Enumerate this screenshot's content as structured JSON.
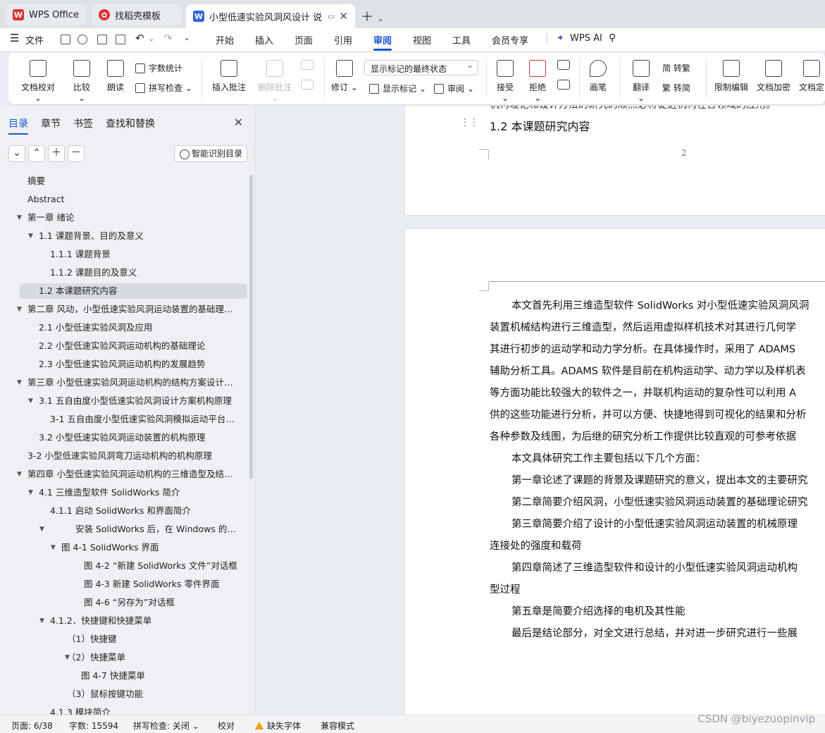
{
  "tabs": [
    {
      "label": "WPS Office",
      "icon": "wps-logo-icon"
    },
    {
      "label": "找稻壳模板",
      "icon": "docer-icon"
    },
    {
      "label": "小型低速实验风洞风设计 说明书",
      "icon": "word-doc-icon",
      "active": true
    }
  ],
  "menu": {
    "file": "文件",
    "items": [
      "开始",
      "插入",
      "页面",
      "引用",
      "审阅",
      "视图",
      "工具",
      "会员专享"
    ],
    "active": "审阅",
    "ai": "WPS AI"
  },
  "ribbon": {
    "doc_proof": "文档校对",
    "compare": "比较",
    "read_aloud": "朗读",
    "word_count": "字数统计",
    "spell_check": "拼写检查",
    "insert_comment": "插入批注",
    "delete_comment": "删除批注",
    "revise": "修订",
    "markup_dropdown": "显示标记的最终状态",
    "show_markup": "显示标记",
    "review": "审阅",
    "accept": "接受",
    "reject": "拒绝",
    "pen": "画笔",
    "translate": "翻译",
    "to_traditional": "简 转繁",
    "to_simplified": "繁 转简",
    "restrict_edit": "限制编辑",
    "encrypt": "文档加密",
    "finalize": "文档定"
  },
  "nav": {
    "tabs": [
      "目录",
      "章节",
      "书签",
      "查找和替换"
    ],
    "active_tab": "目录",
    "smart_button": "智能识别目录",
    "toc": [
      {
        "text": "摘要",
        "level": 0,
        "arrow": ""
      },
      {
        "text": "Abstract",
        "level": 0,
        "arrow": ""
      },
      {
        "text": "第一章  绪论",
        "level": 0,
        "arrow": "down"
      },
      {
        "text": "1.1 课题背景、目的及意义",
        "level": 1,
        "arrow": "down"
      },
      {
        "text": "1.1.1 课题背景",
        "level": 2,
        "arrow": ""
      },
      {
        "text": "1.1.2 课题目的及意义",
        "level": 2,
        "arrow": ""
      },
      {
        "text": "1.2 本课题研究内容",
        "level": 1,
        "arrow": "",
        "selected": true
      },
      {
        "text": "第二章  风动，小型低速实验风洞运动装置的基础理论 ...",
        "level": 0,
        "arrow": "down"
      },
      {
        "text": "2.1 小型低速实验风洞及应用",
        "level": 1,
        "arrow": ""
      },
      {
        "text": "2.2 小型低速实验风洞运动机构的基础理论",
        "level": 1,
        "arrow": ""
      },
      {
        "text": "2.3 小型低速实验风洞运动机构的发展趋势",
        "level": 1,
        "arrow": ""
      },
      {
        "text": "第三章  小型低速实验风洞运动机构的结构方案设计和 ...",
        "level": 0,
        "arrow": "down"
      },
      {
        "text": "3.1 五自由度小型低速实验风洞设计方案机构原理",
        "level": 1,
        "arrow": "down"
      },
      {
        "text": "3-1 五自由度小型低速实验风洞模拟运动平台的 ...",
        "level": 2,
        "arrow": ""
      },
      {
        "text": "3.2 小型低速实验风洞运动装置的机构原理",
        "level": 1,
        "arrow": ""
      },
      {
        "text": "3-2 小型低速实验风洞弯刀运动机构的机构原理",
        "level": 0,
        "arrow": ""
      },
      {
        "text": "第四章    小型低速实验风洞运动机构的三维造型及结构 ...",
        "level": 0,
        "arrow": "down"
      },
      {
        "text": "4.1 三维造型软件 SolidWorks 简介",
        "level": 1,
        "arrow": "down"
      },
      {
        "text": "4.1.1 启动 SolidWorks 和界面简介",
        "level": 2,
        "arrow": ""
      },
      {
        "text": "安装 SolidWorks 后，在 Windows 的操 ...",
        "level": 4,
        "arrow": "down",
        "arrow_level": 2
      },
      {
        "text": "图 4-1    SolidWorks 界面",
        "level": 3,
        "arrow": "down"
      },
      {
        "text": "图 4-2  “新建 SolidWorks 文件”对话框",
        "level": 5,
        "arrow": ""
      },
      {
        "text": "图 4-3    新建 SolidWorks 零件界面",
        "level": 5,
        "arrow": ""
      },
      {
        "text": "图 4-6  “另存为”对话框",
        "level": 5,
        "arrow": ""
      },
      {
        "text": "4.1.2．快捷键和快捷菜单",
        "level": 2,
        "arrow": "down"
      },
      {
        "text": "（1）快捷键",
        "level": 3.4,
        "arrow": ""
      },
      {
        "text": "（2）快捷菜单",
        "level": 3.4,
        "arrow": "down"
      },
      {
        "text": "图 4-7    快捷菜单",
        "level": 4.4,
        "arrow": ""
      },
      {
        "text": "（3）鼠标按键功能",
        "level": 3.4,
        "arrow": ""
      },
      {
        "text": "4.1.3    模块简介",
        "level": 2,
        "arrow": ""
      }
    ]
  },
  "document": {
    "cut_line": "机构理论和设计方法的研究的顺然必将促进机构在各领域的应用。",
    "heading": "1.2 本课题研究内容",
    "page_number": "2",
    "paragraphs": [
      "本文首先利用三维造型软件 SolidWorks 对小型低速实验风洞风洞",
      "装置机械结构进行三维造型，然后运用虚拟样机技术对其进行几何学",
      "其进行初步的运动学和动力学分析。在具体操作时，采用了 ADAMS",
      "辅助分析工具。ADAMS 软件是目前在机构运动学、动力学以及样机表",
      "等方面功能比较强大的软件之一，并联机构运动的复杂性可以利用 A",
      "供的这些功能进行分析，并可以方便、快捷地得到可视化的结果和分析",
      "各种参数及线图，为后继的研究分析工作提供比较直观的可参考依据",
      "本文具体研究工作主要包括以下几个方面：",
      "第一章论述了课题的背景及课题研究的意义，提出本文的主要研究",
      "第二章简要介绍风洞，小型低速实验风洞运动装置的基础理论研究",
      "第三章简要介绍了设计的小型低速实验风洞运动装置的机械原理",
      "连接处的强度和载荷",
      "第四章简述了三维造型软件和设计的小型低速实验风洞运动机构",
      "型过程",
      "第五章是简要介绍选择的电机及其性能",
      "最后是结论部分，对全文进行总结，并对进一步研究进行一些展"
    ]
  },
  "status": {
    "page": "页面: 6/38",
    "words": "字数: 15594",
    "spell": "拼写检查: 关闭",
    "proof": "校对",
    "missing_font": "缺失字体",
    "compat": "兼容模式"
  },
  "watermark": "CSDN @biyezuopinvip",
  "colors": {
    "accent": "#1a56d6",
    "wps_red": "#e0322b"
  }
}
